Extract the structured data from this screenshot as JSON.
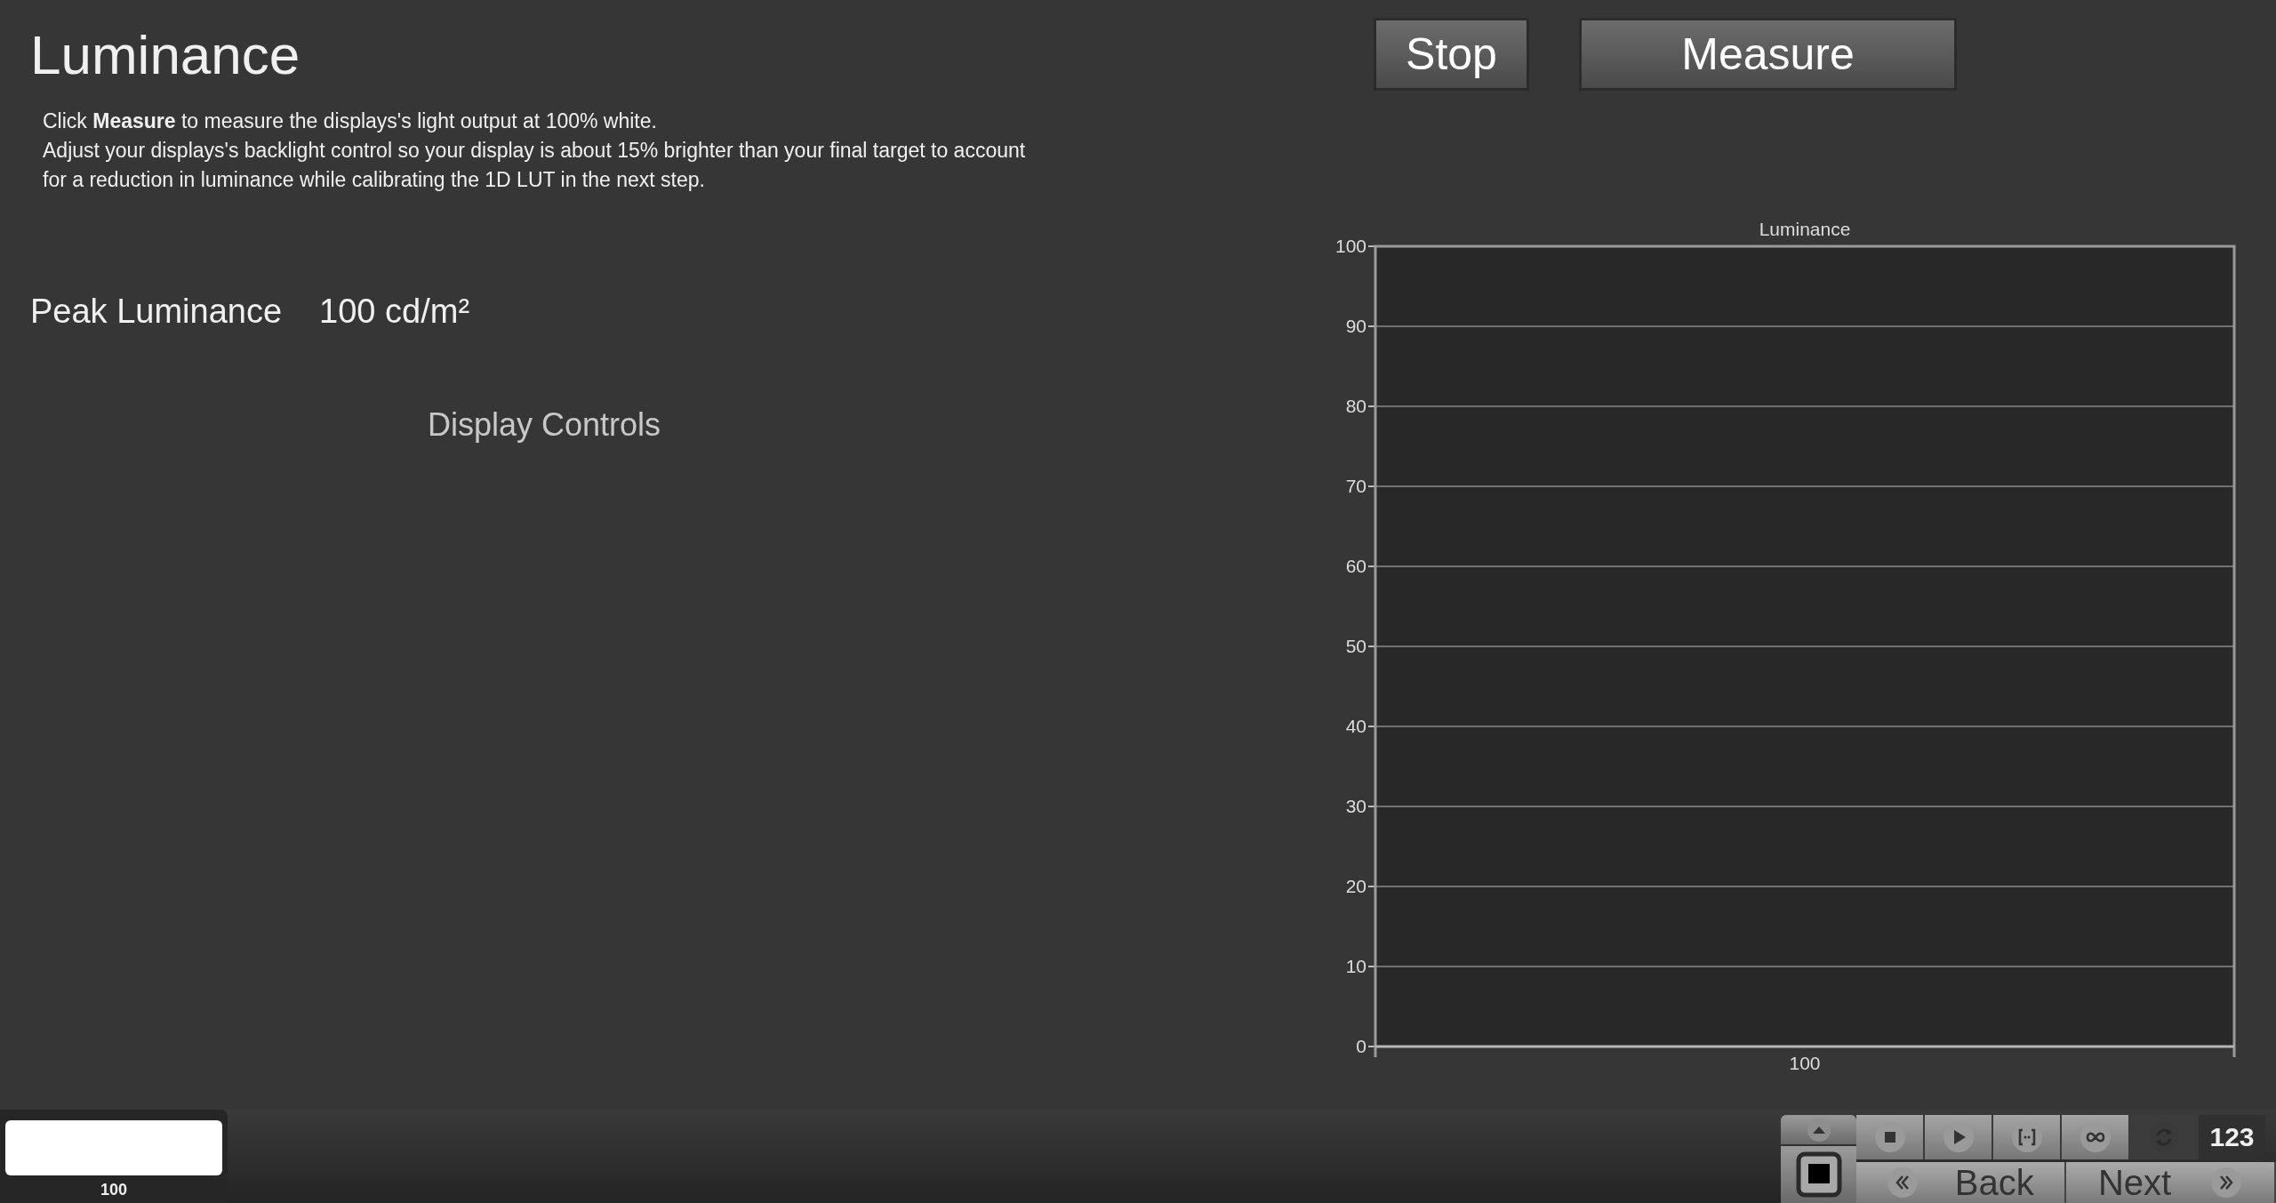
{
  "page_title": "Luminance",
  "instructions": [
    "Click **Measure** to measure the displays's light output at 100% white.",
    "Adjust your displays's backlight control so your display is about 15% brighter than your final target to account for a reduction in luminance while calibrating the 1D LUT in the next step."
  ],
  "peak_luminance": {
    "label": "Peak Luminance",
    "value": "100 cd/m²"
  },
  "display_controls": "Display Controls",
  "buttons": [
    {
      "label": "Stop"
    },
    {
      "label": "Measure"
    }
  ],
  "chart_data": {
    "type": "bar",
    "grid": true,
    "title": "Luminance",
    "categories": [
      "100"
    ],
    "values": [
      null
    ],
    "ylim": [
      0,
      100
    ],
    "yticks": [
      0,
      10,
      20,
      30,
      40,
      50,
      60,
      70,
      80,
      90,
      100
    ]
  },
  "swatch": {
    "label": "100"
  },
  "toolbar": [
    {
      "kind": "stop",
      "disabled": false
    },
    {
      "kind": "play",
      "disabled": false
    },
    {
      "kind": "bracket",
      "disabled": false
    },
    {
      "kind": "loop",
      "disabled": false
    },
    {
      "kind": "refresh",
      "disabled": true
    }
  ],
  "counter": "123",
  "nav": [
    {
      "kind": "back",
      "label": "Back"
    },
    {
      "kind": "next",
      "label": "Next"
    }
  ]
}
